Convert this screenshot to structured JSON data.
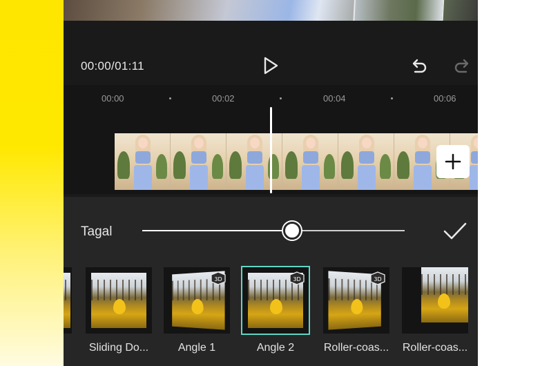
{
  "player": {
    "time_display": "00:00/01:11",
    "play_icon": "play-icon",
    "undo_icon": "undo-icon",
    "redo_icon": "redo-icon"
  },
  "timeline": {
    "ticks": [
      "00:00",
      "00:02",
      "00:04",
      "00:06"
    ],
    "add_icon": "plus-icon"
  },
  "animation_panel": {
    "intensity_label": "Tagal",
    "slider_value": 0.57,
    "confirm_icon": "check-icon",
    "selected_color": "#5fd7c6",
    "effects": [
      {
        "label": "Sliding Do...",
        "badge_3d": false
      },
      {
        "label": "Angle 1",
        "badge_3d": true
      },
      {
        "label": "Angle 2",
        "badge_3d": true,
        "selected": true
      },
      {
        "label": "Roller-coas...",
        "badge_3d": true
      },
      {
        "label": "Roller-coas...",
        "badge_3d": false
      }
    ]
  }
}
